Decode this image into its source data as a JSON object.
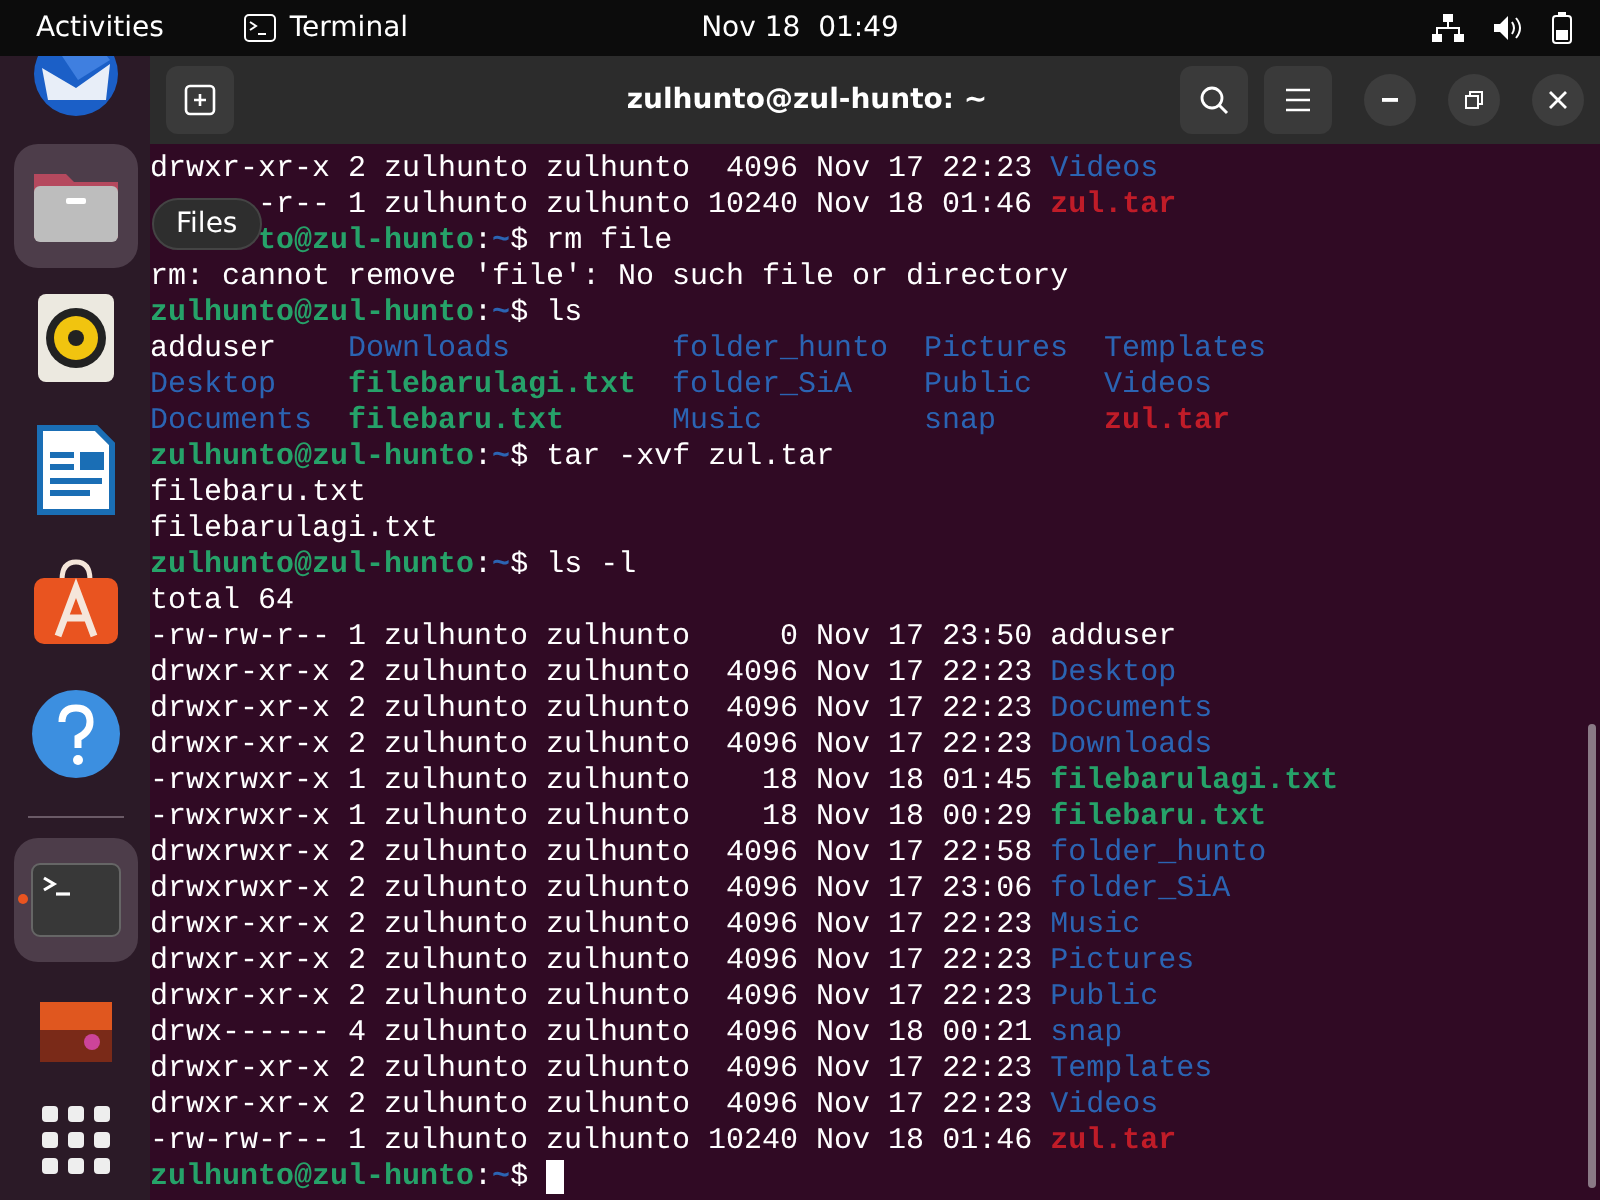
{
  "top_bar": {
    "activities": "Activities",
    "app_name": "Terminal",
    "clock": "Nov 18  01:49"
  },
  "dock": {
    "items": [
      {
        "kind": "mail",
        "highlighted": false,
        "running": false
      },
      {
        "kind": "files",
        "highlighted": true,
        "running": false
      },
      {
        "kind": "music",
        "highlighted": false,
        "running": false
      },
      {
        "kind": "writer",
        "highlighted": false,
        "running": false
      },
      {
        "kind": "store",
        "highlighted": false,
        "running": false
      },
      {
        "kind": "help",
        "highlighted": false,
        "running": false
      },
      {
        "kind": "separator"
      },
      {
        "kind": "terminal",
        "highlighted": true,
        "running": true
      },
      {
        "kind": "image-app",
        "highlighted": false,
        "running": false
      }
    ],
    "tooltip": "Files"
  },
  "window": {
    "title": "zulhunto@zul-hunto: ~"
  },
  "terminal": {
    "lines": [
      {
        "kind": "long",
        "covered": false,
        "meta": "drwxr-xr-x 2 zulhunto zulhunto  4096 Nov 17 22:23",
        "file": {
          "name": "Videos",
          "kind": "dir"
        }
      },
      {
        "kind": "long",
        "covered": true,
        "meta": "-r-- 1 zulhunto zulhunto 10240 Nov 18 01:46",
        "file": {
          "name": "zul.tar",
          "kind": "archive"
        }
      },
      {
        "kind": "prompt",
        "covered": true,
        "user": "to@zul-hunto",
        "sep": ":",
        "path": "~",
        "sigil": "$",
        "command": "rm file",
        "cursor": false
      },
      {
        "kind": "output",
        "covered": false,
        "text": "rm: cannot remove 'file': No such file or directory"
      },
      {
        "kind": "prompt",
        "covered": false,
        "user": "zulhunto@zul-hunto",
        "sep": ":",
        "path": "~",
        "sigil": "$",
        "command": "ls",
        "cursor": false
      },
      {
        "kind": "listing",
        "covered": false,
        "entries": [
          {
            "name": "adduser",
            "kind": "plain"
          },
          {
            "name": "Downloads",
            "kind": "dir"
          },
          {
            "name": "folder_hunto",
            "kind": "dir"
          },
          {
            "name": "Pictures",
            "kind": "dir"
          },
          {
            "name": "Templates",
            "kind": "dir"
          }
        ]
      },
      {
        "kind": "listing",
        "covered": false,
        "entries": [
          {
            "name": "Desktop",
            "kind": "dir"
          },
          {
            "name": "filebarulagi.txt",
            "kind": "exec"
          },
          {
            "name": "folder_SiA",
            "kind": "dir"
          },
          {
            "name": "Public",
            "kind": "dir"
          },
          {
            "name": "Videos",
            "kind": "dir"
          }
        ]
      },
      {
        "kind": "listing",
        "covered": false,
        "entries": [
          {
            "name": "Documents",
            "kind": "dir"
          },
          {
            "name": "filebaru.txt",
            "kind": "exec"
          },
          {
            "name": "Music",
            "kind": "dir"
          },
          {
            "name": "snap",
            "kind": "dir"
          },
          {
            "name": "zul.tar",
            "kind": "archive"
          }
        ]
      },
      {
        "kind": "prompt",
        "covered": false,
        "user": "zulhunto@zul-hunto",
        "sep": ":",
        "path": "~",
        "sigil": "$",
        "command": "tar -xvf zul.tar",
        "cursor": false
      },
      {
        "kind": "output",
        "covered": false,
        "text": "filebaru.txt"
      },
      {
        "kind": "output",
        "covered": false,
        "text": "filebarulagi.txt"
      },
      {
        "kind": "prompt",
        "covered": false,
        "user": "zulhunto@zul-hunto",
        "sep": ":",
        "path": "~",
        "sigil": "$",
        "command": "ls -l",
        "cursor": false
      },
      {
        "kind": "output",
        "covered": false,
        "text": "total 64"
      },
      {
        "kind": "long",
        "covered": false,
        "meta": "-rw-rw-r-- 1 zulhunto zulhunto     0 Nov 17 23:50",
        "file": {
          "name": "adduser",
          "kind": "plain"
        }
      },
      {
        "kind": "long",
        "covered": false,
        "meta": "drwxr-xr-x 2 zulhunto zulhunto  4096 Nov 17 22:23",
        "file": {
          "name": "Desktop",
          "kind": "dir"
        }
      },
      {
        "kind": "long",
        "covered": false,
        "meta": "drwxr-xr-x 2 zulhunto zulhunto  4096 Nov 17 22:23",
        "file": {
          "name": "Documents",
          "kind": "dir"
        }
      },
      {
        "kind": "long",
        "covered": false,
        "meta": "drwxr-xr-x 2 zulhunto zulhunto  4096 Nov 17 22:23",
        "file": {
          "name": "Downloads",
          "kind": "dir"
        }
      },
      {
        "kind": "long",
        "covered": false,
        "meta": "-rwxrwxr-x 1 zulhunto zulhunto    18 Nov 18 01:45",
        "file": {
          "name": "filebarulagi.txt",
          "kind": "exec"
        }
      },
      {
        "kind": "long",
        "covered": false,
        "meta": "-rwxrwxr-x 1 zulhunto zulhunto    18 Nov 18 00:29",
        "file": {
          "name": "filebaru.txt",
          "kind": "exec"
        }
      },
      {
        "kind": "long",
        "covered": false,
        "meta": "drwxrwxr-x 2 zulhunto zulhunto  4096 Nov 17 22:58",
        "file": {
          "name": "folder_hunto",
          "kind": "dir"
        }
      },
      {
        "kind": "long",
        "covered": false,
        "meta": "drwxrwxr-x 2 zulhunto zulhunto  4096 Nov 17 23:06",
        "file": {
          "name": "folder_SiA",
          "kind": "dir"
        }
      },
      {
        "kind": "long",
        "covered": false,
        "meta": "drwxr-xr-x 2 zulhunto zulhunto  4096 Nov 17 22:23",
        "file": {
          "name": "Music",
          "kind": "dir"
        }
      },
      {
        "kind": "long",
        "covered": false,
        "meta": "drwxr-xr-x 2 zulhunto zulhunto  4096 Nov 17 22:23",
        "file": {
          "name": "Pictures",
          "kind": "dir"
        }
      },
      {
        "kind": "long",
        "covered": false,
        "meta": "drwxr-xr-x 2 zulhunto zulhunto  4096 Nov 17 22:23",
        "file": {
          "name": "Public",
          "kind": "dir"
        }
      },
      {
        "kind": "long",
        "covered": false,
        "meta": "drwx------ 4 zulhunto zulhunto  4096 Nov 18 00:21",
        "file": {
          "name": "snap",
          "kind": "dir"
        }
      },
      {
        "kind": "long",
        "covered": false,
        "meta": "drwxr-xr-x 2 zulhunto zulhunto  4096 Nov 17 22:23",
        "file": {
          "name": "Templates",
          "kind": "dir"
        }
      },
      {
        "kind": "long",
        "covered": false,
        "meta": "drwxr-xr-x 2 zulhunto zulhunto  4096 Nov 17 22:23",
        "file": {
          "name": "Videos",
          "kind": "dir"
        }
      },
      {
        "kind": "long",
        "covered": false,
        "meta": "-rw-rw-r-- 1 zulhunto zulhunto 10240 Nov 18 01:46",
        "file": {
          "name": "zul.tar",
          "kind": "archive"
        }
      },
      {
        "kind": "prompt",
        "covered": false,
        "user": "zulhunto@zul-hunto",
        "sep": ":",
        "path": "~",
        "sigil": "$",
        "cursor": true
      }
    ]
  }
}
